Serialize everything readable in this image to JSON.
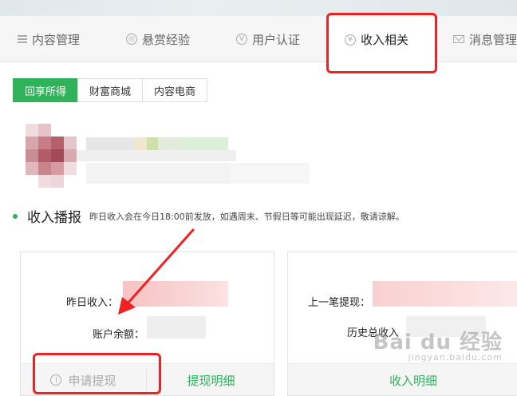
{
  "nav": {
    "items": [
      {
        "label": "内容管理",
        "icon": "list-icon"
      },
      {
        "label": "悬赏经验",
        "icon": "coin-icon"
      },
      {
        "label": "用户认证",
        "icon": "verify-icon",
        "icon_glyph": "V"
      },
      {
        "label": "收入相关",
        "icon": "yuan-icon",
        "icon_glyph": "¥",
        "active": true
      },
      {
        "label": "消息管理",
        "icon": "mail-icon"
      }
    ]
  },
  "subtabs": [
    "回享所得",
    "财富商城",
    "内容电商"
  ],
  "income": {
    "title": "收入播报",
    "note": "昨日收入会在今日18:00前发放，如遇周末、节假日等可能出现延迟，敬请谅解。",
    "left_card": {
      "yesterday_label": "昨日收入：",
      "balance_label": "账户余额：",
      "withdraw_button": "申请提现",
      "withdraw_detail": "提现明细"
    },
    "right_card": {
      "last_withdraw_label": "上一笔提现：",
      "total_income_label": "历史总收入",
      "income_detail": "收入明细"
    }
  },
  "watermark": {
    "text": "Bai du 经验",
    "sub": "jingyan.baidu.com"
  },
  "colors": {
    "accent": "#2fb25a",
    "annotation": "#ee2222"
  }
}
